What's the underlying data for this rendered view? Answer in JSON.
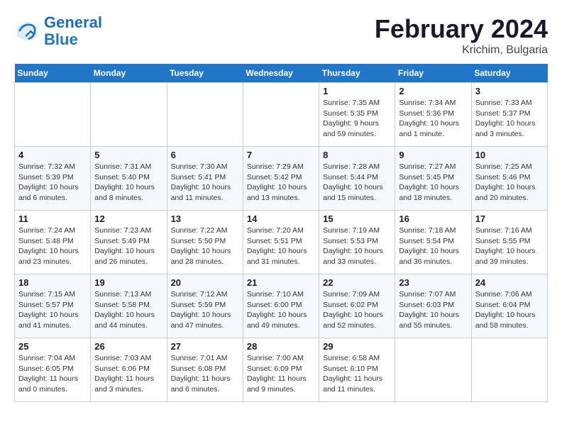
{
  "header": {
    "logo_line1": "General",
    "logo_line2": "Blue",
    "title": "February 2024",
    "subtitle": "Krichim, Bulgaria"
  },
  "weekdays": [
    "Sunday",
    "Monday",
    "Tuesday",
    "Wednesday",
    "Thursday",
    "Friday",
    "Saturday"
  ],
  "weeks": [
    [
      {
        "day": "",
        "info": ""
      },
      {
        "day": "",
        "info": ""
      },
      {
        "day": "",
        "info": ""
      },
      {
        "day": "",
        "info": ""
      },
      {
        "day": "1",
        "info": "Sunrise: 7:35 AM\nSunset: 5:35 PM\nDaylight: 9 hours and 59 minutes."
      },
      {
        "day": "2",
        "info": "Sunrise: 7:34 AM\nSunset: 5:36 PM\nDaylight: 10 hours and 1 minute."
      },
      {
        "day": "3",
        "info": "Sunrise: 7:33 AM\nSunset: 5:37 PM\nDaylight: 10 hours and 3 minutes."
      }
    ],
    [
      {
        "day": "4",
        "info": "Sunrise: 7:32 AM\nSunset: 5:39 PM\nDaylight: 10 hours and 6 minutes."
      },
      {
        "day": "5",
        "info": "Sunrise: 7:31 AM\nSunset: 5:40 PM\nDaylight: 10 hours and 8 minutes."
      },
      {
        "day": "6",
        "info": "Sunrise: 7:30 AM\nSunset: 5:41 PM\nDaylight: 10 hours and 11 minutes."
      },
      {
        "day": "7",
        "info": "Sunrise: 7:29 AM\nSunset: 5:42 PM\nDaylight: 10 hours and 13 minutes."
      },
      {
        "day": "8",
        "info": "Sunrise: 7:28 AM\nSunset: 5:44 PM\nDaylight: 10 hours and 15 minutes."
      },
      {
        "day": "9",
        "info": "Sunrise: 7:27 AM\nSunset: 5:45 PM\nDaylight: 10 hours and 18 minutes."
      },
      {
        "day": "10",
        "info": "Sunrise: 7:25 AM\nSunset: 5:46 PM\nDaylight: 10 hours and 20 minutes."
      }
    ],
    [
      {
        "day": "11",
        "info": "Sunrise: 7:24 AM\nSunset: 5:48 PM\nDaylight: 10 hours and 23 minutes."
      },
      {
        "day": "12",
        "info": "Sunrise: 7:23 AM\nSunset: 5:49 PM\nDaylight: 10 hours and 26 minutes."
      },
      {
        "day": "13",
        "info": "Sunrise: 7:22 AM\nSunset: 5:50 PM\nDaylight: 10 hours and 28 minutes."
      },
      {
        "day": "14",
        "info": "Sunrise: 7:20 AM\nSunset: 5:51 PM\nDaylight: 10 hours and 31 minutes."
      },
      {
        "day": "15",
        "info": "Sunrise: 7:19 AM\nSunset: 5:53 PM\nDaylight: 10 hours and 33 minutes."
      },
      {
        "day": "16",
        "info": "Sunrise: 7:18 AM\nSunset: 5:54 PM\nDaylight: 10 hours and 36 minutes."
      },
      {
        "day": "17",
        "info": "Sunrise: 7:16 AM\nSunset: 5:55 PM\nDaylight: 10 hours and 39 minutes."
      }
    ],
    [
      {
        "day": "18",
        "info": "Sunrise: 7:15 AM\nSunset: 5:57 PM\nDaylight: 10 hours and 41 minutes."
      },
      {
        "day": "19",
        "info": "Sunrise: 7:13 AM\nSunset: 5:58 PM\nDaylight: 10 hours and 44 minutes."
      },
      {
        "day": "20",
        "info": "Sunrise: 7:12 AM\nSunset: 5:59 PM\nDaylight: 10 hours and 47 minutes."
      },
      {
        "day": "21",
        "info": "Sunrise: 7:10 AM\nSunset: 6:00 PM\nDaylight: 10 hours and 49 minutes."
      },
      {
        "day": "22",
        "info": "Sunrise: 7:09 AM\nSunset: 6:02 PM\nDaylight: 10 hours and 52 minutes."
      },
      {
        "day": "23",
        "info": "Sunrise: 7:07 AM\nSunset: 6:03 PM\nDaylight: 10 hours and 55 minutes."
      },
      {
        "day": "24",
        "info": "Sunrise: 7:06 AM\nSunset: 6:04 PM\nDaylight: 10 hours and 58 minutes."
      }
    ],
    [
      {
        "day": "25",
        "info": "Sunrise: 7:04 AM\nSunset: 6:05 PM\nDaylight: 11 hours and 0 minutes."
      },
      {
        "day": "26",
        "info": "Sunrise: 7:03 AM\nSunset: 6:06 PM\nDaylight: 11 hours and 3 minutes."
      },
      {
        "day": "27",
        "info": "Sunrise: 7:01 AM\nSunset: 6:08 PM\nDaylight: 11 hours and 6 minutes."
      },
      {
        "day": "28",
        "info": "Sunrise: 7:00 AM\nSunset: 6:09 PM\nDaylight: 11 hours and 9 minutes."
      },
      {
        "day": "29",
        "info": "Sunrise: 6:58 AM\nSunset: 6:10 PM\nDaylight: 11 hours and 11 minutes."
      },
      {
        "day": "",
        "info": ""
      },
      {
        "day": "",
        "info": ""
      }
    ]
  ]
}
